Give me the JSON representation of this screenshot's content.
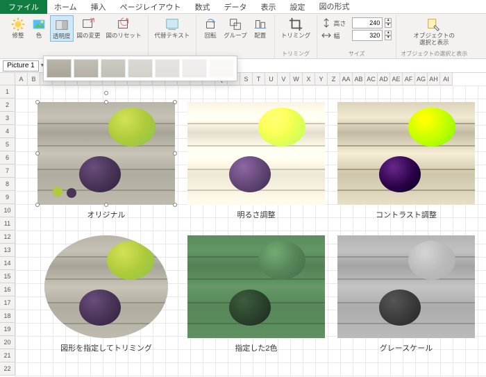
{
  "menu": {
    "file": "ファイル",
    "tabs": [
      "ホーム",
      "挿入",
      "ページレイアウト",
      "数式",
      "データ",
      "表示",
      "設定",
      "図の形式"
    ],
    "active": 7
  },
  "ribbon": {
    "adjust": {
      "correct": "修整",
      "color": "色",
      "transparency": "透明度",
      "change": "図の変更",
      "reset": "図のリセット"
    },
    "alt": "代替テキスト",
    "arrange": {
      "rotate": "回転",
      "group": "グループ",
      "align": "配置",
      "label": ""
    },
    "crop": {
      "btn": "トリミング",
      "label": "トリミング"
    },
    "size": {
      "h": "高さ",
      "w": "幅",
      "hval": "240",
      "wval": "320",
      "label": "サイズ"
    },
    "obj": {
      "l1": "オブジェクトの",
      "l2": "選択と表示",
      "label": "オブジェクトの選択と表示"
    }
  },
  "namebox": "Picture 1",
  "cols": [
    "A",
    "B",
    "C",
    "D",
    "E",
    "F",
    "G",
    "H",
    "I",
    "J",
    "K",
    "L",
    "M",
    "N",
    "O",
    "P",
    "Q",
    "R",
    "S",
    "T",
    "U",
    "V",
    "W",
    "X",
    "Y",
    "Z",
    "AA",
    "AB",
    "AC",
    "AD",
    "AE",
    "AF",
    "AG",
    "AH",
    "AI"
  ],
  "rows": [
    "1",
    "2",
    "3",
    "4",
    "5",
    "6",
    "7",
    "8",
    "9",
    "10",
    "11",
    "12",
    "13",
    "14",
    "15",
    "16",
    "17",
    "18",
    "19",
    "20",
    "21",
    "22"
  ],
  "labels": {
    "a": "オリジナル",
    "b": "明るさ調整",
    "c": "コントラスト調整",
    "d": "図形を指定してトリミング",
    "e": "指定した2色",
    "f": "グレースケール"
  }
}
